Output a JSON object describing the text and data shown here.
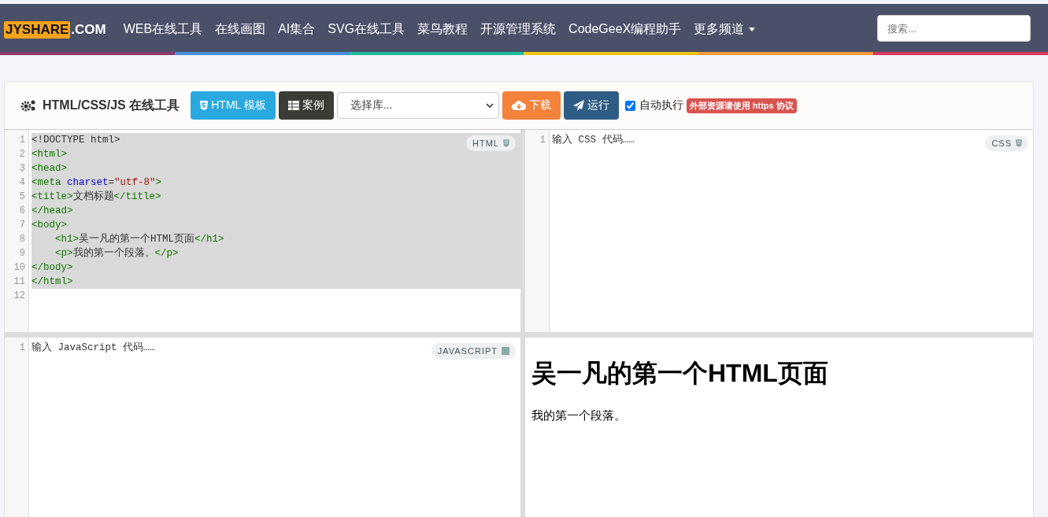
{
  "navbar": {
    "logo_box": "JYSHARE",
    "logo_suffix": ".COM",
    "links": [
      {
        "label": "WEB在线工具",
        "dropdown": false
      },
      {
        "label": "在线画图",
        "dropdown": false
      },
      {
        "label": "AI集合",
        "dropdown": false
      },
      {
        "label": "SVG在线工具",
        "dropdown": false
      },
      {
        "label": "菜鸟教程",
        "dropdown": false
      },
      {
        "label": "开源管理系统",
        "dropdown": false
      },
      {
        "label": "CodeGeeX编程助手",
        "dropdown": false
      },
      {
        "label": "更多频道",
        "dropdown": true
      }
    ],
    "search": {
      "placeholder": "搜索..."
    }
  },
  "toolbar": {
    "title": "HTML/CSS/JS 在线工具",
    "buttons": [
      {
        "kind": "template",
        "label": "HTML 模板"
      },
      {
        "kind": "examples",
        "label": "案例"
      }
    ],
    "library_select": {
      "placeholder": "选择库..."
    },
    "actions": [
      {
        "kind": "download",
        "label": "下载"
      },
      {
        "kind": "run",
        "label": "运行"
      }
    ],
    "auto_run": {
      "label": "自动执行",
      "checked": true
    },
    "notice": "外部资源请使用 https 协议"
  },
  "editors": [
    {
      "kind": "html",
      "badge": "HTML",
      "lines": [
        {
          "number": "1",
          "selected": true,
          "tokens": [
            {
              "kind": "text",
              "text": "<!DOCTYPE html>"
            }
          ]
        },
        {
          "number": "2",
          "selected": true,
          "tokens": [
            {
              "kind": "tag",
              "text": "<html>"
            }
          ]
        },
        {
          "number": "3",
          "selected": true,
          "tokens": [
            {
              "kind": "tag",
              "text": "<head>"
            }
          ]
        },
        {
          "number": "4",
          "selected": true,
          "tokens": [
            {
              "kind": "tag",
              "text": "<meta "
            },
            {
              "kind": "attr",
              "text": "charset"
            },
            {
              "kind": "text",
              "text": "="
            },
            {
              "kind": "string",
              "text": "\"utf-8\""
            },
            {
              "kind": "tag",
              "text": ">"
            }
          ]
        },
        {
          "number": "5",
          "selected": true,
          "tokens": [
            {
              "kind": "tag",
              "text": "<title>"
            },
            {
              "kind": "text",
              "text": "文档标题"
            },
            {
              "kind": "tag",
              "text": "</title>"
            }
          ]
        },
        {
          "number": "6",
          "selected": true,
          "tokens": [
            {
              "kind": "tag",
              "text": "</head>"
            }
          ]
        },
        {
          "number": "7",
          "selected": true,
          "tokens": [
            {
              "kind": "tag",
              "text": "<body>"
            }
          ]
        },
        {
          "number": "8",
          "selected": true,
          "tokens": [
            {
              "kind": "tag",
              "text": "    <h1>"
            },
            {
              "kind": "text",
              "text": "吴一凡的第一个HTML页面"
            },
            {
              "kind": "tag",
              "text": "</h1>"
            }
          ]
        },
        {
          "number": "9",
          "selected": true,
          "tokens": [
            {
              "kind": "tag",
              "text": "    <p>"
            },
            {
              "kind": "text",
              "text": "我的第一个段落。"
            },
            {
              "kind": "tag",
              "text": "</p>"
            }
          ]
        },
        {
          "number": "10",
          "selected": true,
          "tokens": [
            {
              "kind": "tag",
              "text": "</body>"
            }
          ]
        },
        {
          "number": "11",
          "selected": true,
          "tokens": [
            {
              "kind": "tag",
              "text": "</html>"
            }
          ]
        },
        {
          "number": "12",
          "selected": false
        }
      ]
    },
    {
      "kind": "css",
      "badge": "CSS",
      "lines": [
        {
          "number": "1",
          "selected": false,
          "tokens": [
            {
              "kind": "text",
              "text": "输入 CSS 代码……"
            }
          ]
        }
      ]
    },
    {
      "kind": "js",
      "badge": "JAVASCRIPT",
      "lines": [
        {
          "number": "1",
          "selected": false,
          "tokens": [
            {
              "kind": "text",
              "text": "输入 JavaScript 代码……"
            }
          ]
        }
      ]
    }
  ],
  "preview": {
    "heading": "吴一凡的第一个HTML页面",
    "paragraph": "我的第一个段落。"
  }
}
